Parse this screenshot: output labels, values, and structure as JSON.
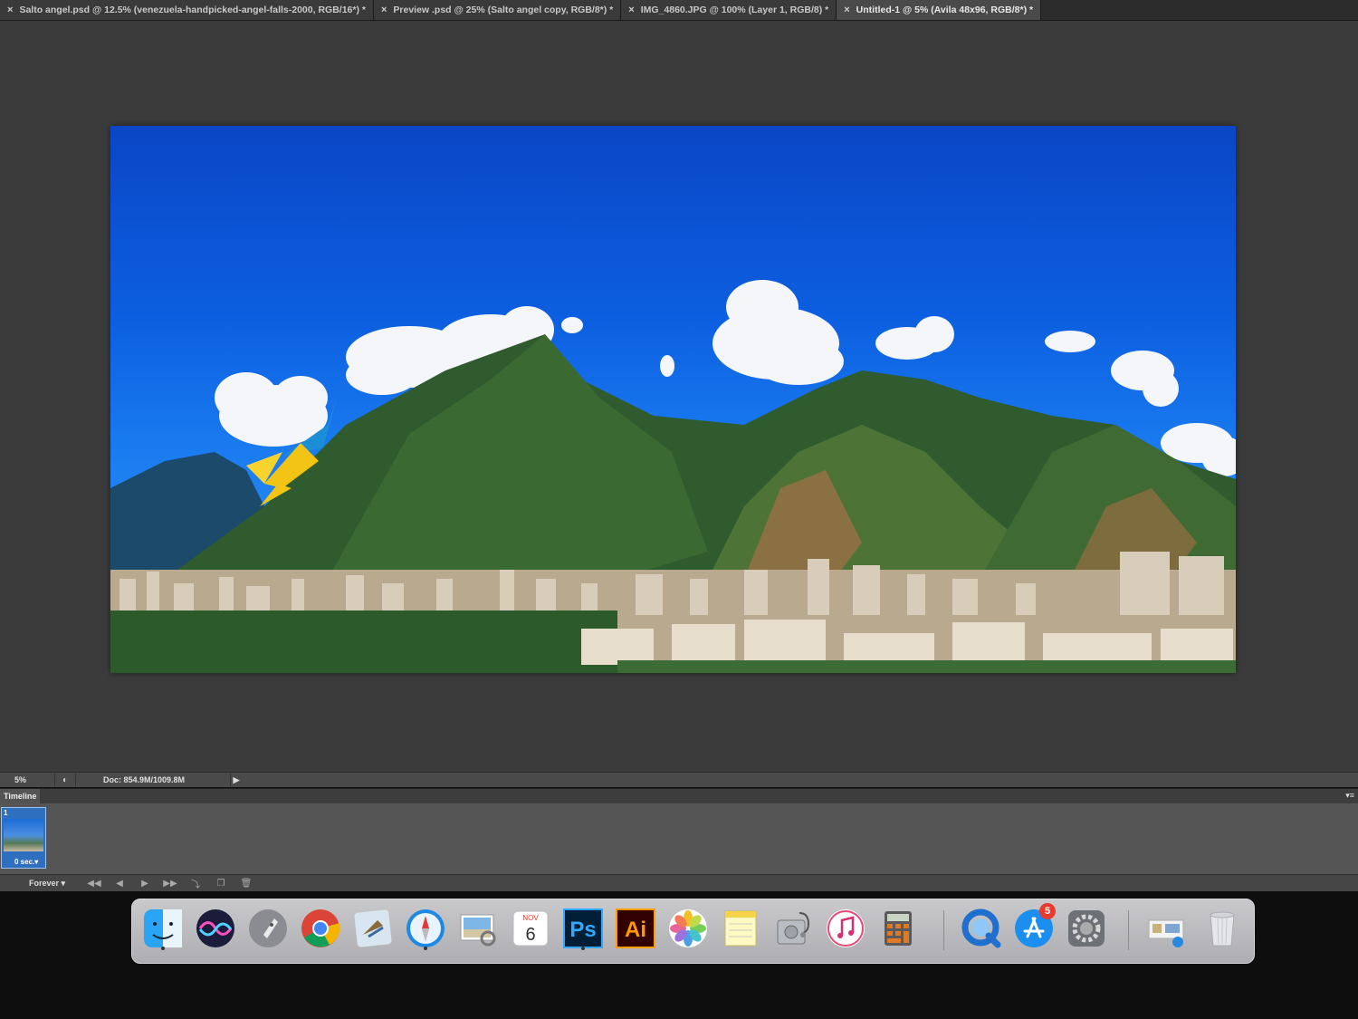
{
  "tabs": [
    {
      "label": "Salto angel.psd @ 12.5% (venezuela-handpicked-angel-falls-2000, RGB/16*) *",
      "close": "×"
    },
    {
      "label": "Preview .psd @ 25% (Salto angel copy, RGB/8*) *",
      "close": "×"
    },
    {
      "label": "IMG_4860.JPG @ 100% (Layer 1, RGB/8) *",
      "close": "×"
    },
    {
      "label": "Untitled-1 @ 5% (Avila 48x96, RGB/8*) *",
      "close": "×"
    }
  ],
  "status": {
    "zoom": "5%",
    "doc": "Doc: 854.9M/1009.8M",
    "arrow": "▶"
  },
  "timeline": {
    "tab_label": "Timeline",
    "menu": "▾≡",
    "frame_number": "1",
    "frame_delay": "0 sec.▾",
    "loop": "Forever ▾",
    "controls": [
      "◀◀",
      "◀",
      "▶",
      "▶▶",
      "⤵",
      "❐",
      "🗑"
    ]
  },
  "dock": {
    "items": [
      {
        "name": "finder-icon"
      },
      {
        "name": "siri-icon"
      },
      {
        "name": "launchpad-icon"
      },
      {
        "name": "chrome-icon"
      },
      {
        "name": "mail-icon"
      },
      {
        "name": "safari-icon"
      },
      {
        "name": "preview-icon"
      },
      {
        "name": "calendar-icon",
        "month": "NOV",
        "day": "6"
      },
      {
        "name": "photoshop-icon",
        "text": "Ps"
      },
      {
        "name": "illustrator-icon",
        "text": "Ai"
      },
      {
        "name": "photos-icon"
      },
      {
        "name": "notes-icon"
      },
      {
        "name": "disk-utility-icon"
      },
      {
        "name": "itunes-icon"
      },
      {
        "name": "calculator-icon"
      },
      {
        "name": "quicktime-icon"
      },
      {
        "name": "app-store-icon",
        "badge": "5"
      },
      {
        "name": "system-preferences-icon"
      },
      {
        "name": "downloads-stack-icon"
      },
      {
        "name": "trash-icon"
      }
    ]
  },
  "colors": {
    "sky_top": "#0a46c6",
    "ps_blue": "#31a8ff",
    "ai_orange": "#ff9a00"
  }
}
